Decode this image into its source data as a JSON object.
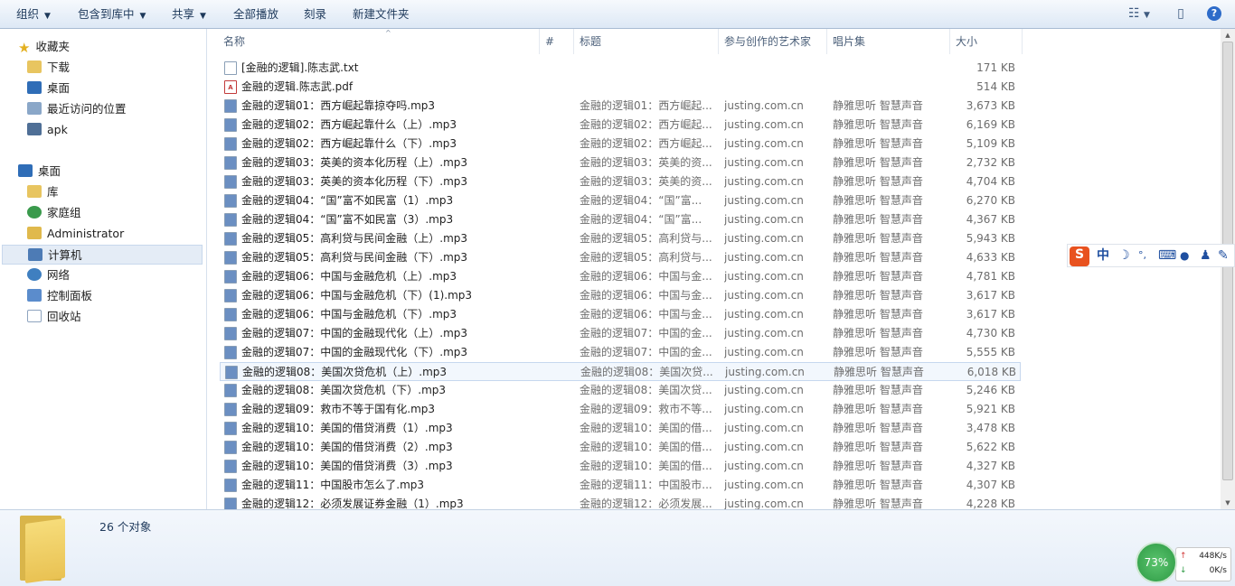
{
  "toolbar": {
    "organize": "组织",
    "include_in_library": "包含到库中",
    "share": "共享",
    "play_all": "全部播放",
    "burn": "刻录",
    "new_folder": "新建文件夹",
    "help": "?"
  },
  "nav": {
    "favorites": "收藏夹",
    "downloads": "下载",
    "desktop_fav": "桌面",
    "recent": "最近访问的位置",
    "apk": "apk",
    "desktop": "桌面",
    "libraries": "库",
    "homegroup": "家庭组",
    "admin": "Administrator",
    "computer": "计算机",
    "network": "网络",
    "control_panel": "控制面板",
    "recycle_bin": "回收站"
  },
  "columns": {
    "name": "名称",
    "track": "#",
    "title": "标题",
    "artist": "参与创作的艺术家",
    "album": "唱片集",
    "size": "大小"
  },
  "files": [
    {
      "type": "txt",
      "name": "[金融的逻辑].陈志武.txt",
      "title": "",
      "artist": "",
      "album": "",
      "size": "171 KB"
    },
    {
      "type": "pdf",
      "name": "金融的逻辑.陈志武.pdf",
      "title": "",
      "artist": "",
      "album": "",
      "size": "514 KB"
    },
    {
      "type": "mp3",
      "name": "金融的逻辑01：西方崛起靠掠夺吗.mp3",
      "title": "金融的逻辑01：西方崛起...",
      "artist": "justing.com.cn",
      "album": "静雅思听 智慧声音",
      "size": "3,673 KB"
    },
    {
      "type": "mp3",
      "name": "金融的逻辑02：西方崛起靠什么（上）.mp3",
      "title": "金融的逻辑02：西方崛起...",
      "artist": "justing.com.cn",
      "album": "静雅思听 智慧声音",
      "size": "6,169 KB"
    },
    {
      "type": "mp3",
      "name": "金融的逻辑02：西方崛起靠什么（下）.mp3",
      "title": "金融的逻辑02：西方崛起...",
      "artist": "justing.com.cn",
      "album": "静雅思听 智慧声音",
      "size": "5,109 KB"
    },
    {
      "type": "mp3",
      "name": "金融的逻辑03：英美的资本化历程（上）.mp3",
      "title": "金融的逻辑03：英美的资...",
      "artist": "justing.com.cn",
      "album": "静雅思听 智慧声音",
      "size": "2,732 KB"
    },
    {
      "type": "mp3",
      "name": "金融的逻辑03：英美的资本化历程（下）.mp3",
      "title": "金融的逻辑03：英美的资...",
      "artist": "justing.com.cn",
      "album": "静雅思听 智慧声音",
      "size": "4,704 KB"
    },
    {
      "type": "mp3",
      "name": "金融的逻辑04：“国”富不如民富（1）.mp3",
      "title": "金融的逻辑04：“国”富...",
      "artist": "justing.com.cn",
      "album": "静雅思听 智慧声音",
      "size": "6,270 KB"
    },
    {
      "type": "mp3",
      "name": "金融的逻辑04：“国”富不如民富（3）.mp3",
      "title": "金融的逻辑04：“国”富...",
      "artist": "justing.com.cn",
      "album": "静雅思听 智慧声音",
      "size": "4,367 KB"
    },
    {
      "type": "mp3",
      "name": "金融的逻辑05：高利贷与民间金融（上）.mp3",
      "title": "金融的逻辑05：高利贷与...",
      "artist": "justing.com.cn",
      "album": "静雅思听 智慧声音",
      "size": "5,943 KB"
    },
    {
      "type": "mp3",
      "name": "金融的逻辑05：高利贷与民间金融（下）.mp3",
      "title": "金融的逻辑05：高利贷与...",
      "artist": "justing.com.cn",
      "album": "静雅思听 智慧声音",
      "size": "4,633 KB"
    },
    {
      "type": "mp3",
      "name": "金融的逻辑06：中国与金融危机（上）.mp3",
      "title": "金融的逻辑06：中国与金...",
      "artist": "justing.com.cn",
      "album": "静雅思听 智慧声音",
      "size": "4,781 KB"
    },
    {
      "type": "mp3",
      "name": "金融的逻辑06：中国与金融危机（下）(1).mp3",
      "title": "金融的逻辑06：中国与金...",
      "artist": "justing.com.cn",
      "album": "静雅思听 智慧声音",
      "size": "3,617 KB"
    },
    {
      "type": "mp3",
      "name": "金融的逻辑06：中国与金融危机（下）.mp3",
      "title": "金融的逻辑06：中国与金...",
      "artist": "justing.com.cn",
      "album": "静雅思听 智慧声音",
      "size": "3,617 KB"
    },
    {
      "type": "mp3",
      "name": "金融的逻辑07：中国的金融现代化（上）.mp3",
      "title": "金融的逻辑07：中国的金...",
      "artist": "justing.com.cn",
      "album": "静雅思听 智慧声音",
      "size": "4,730 KB"
    },
    {
      "type": "mp3",
      "name": "金融的逻辑07：中国的金融现代化（下）.mp3",
      "title": "金融的逻辑07：中国的金...",
      "artist": "justing.com.cn",
      "album": "静雅思听 智慧声音",
      "size": "5,555 KB"
    },
    {
      "type": "mp3",
      "name": "金融的逻辑08：美国次贷危机（上）.mp3",
      "title": "金融的逻辑08：美国次贷...",
      "artist": "justing.com.cn",
      "album": "静雅思听 智慧声音",
      "size": "6,018 KB"
    },
    {
      "type": "mp3",
      "name": "金融的逻辑08：美国次贷危机（下）.mp3",
      "title": "金融的逻辑08：美国次贷...",
      "artist": "justing.com.cn",
      "album": "静雅思听 智慧声音",
      "size": "5,246 KB"
    },
    {
      "type": "mp3",
      "name": "金融的逻辑09：救市不等于国有化.mp3",
      "title": "金融的逻辑09：救市不等...",
      "artist": "justing.com.cn",
      "album": "静雅思听 智慧声音",
      "size": "5,921 KB"
    },
    {
      "type": "mp3",
      "name": "金融的逻辑10：美国的借贷消费（1）.mp3",
      "title": "金融的逻辑10：美国的借...",
      "artist": "justing.com.cn",
      "album": "静雅思听 智慧声音",
      "size": "3,478 KB"
    },
    {
      "type": "mp3",
      "name": "金融的逻辑10：美国的借贷消费（2）.mp3",
      "title": "金融的逻辑10：美国的借...",
      "artist": "justing.com.cn",
      "album": "静雅思听 智慧声音",
      "size": "5,622 KB"
    },
    {
      "type": "mp3",
      "name": "金融的逻辑10：美国的借贷消费（3）.mp3",
      "title": "金融的逻辑10：美国的借...",
      "artist": "justing.com.cn",
      "album": "静雅思听 智慧声音",
      "size": "4,327 KB"
    },
    {
      "type": "mp3",
      "name": "金融的逻辑11：中国股市怎么了.mp3",
      "title": "金融的逻辑11：中国股市...",
      "artist": "justing.com.cn",
      "album": "静雅思听 智慧声音",
      "size": "4,307 KB"
    },
    {
      "type": "mp3",
      "name": "金融的逻辑12：必须发展证券金融（1）.mp3",
      "title": "金融的逻辑12：必须发展...",
      "artist": "justing.com.cn",
      "album": "静雅思听 智慧声音",
      "size": "4,228 KB"
    }
  ],
  "status": {
    "count": "26 个对象"
  },
  "ime": {
    "logo": "S",
    "lang": "中",
    "moon": "☽",
    "punct": "°,",
    "keyboard": "⌨",
    "user": "●",
    "shirt": "♟",
    "tools": "✎"
  },
  "net": {
    "percent": "73%",
    "up": "448K/s",
    "down": "0K/s",
    "up_arrow": "↑",
    "down_arrow": "↓"
  },
  "icons": {
    "caret": "▼",
    "view": "☷",
    "pane": "▯"
  }
}
